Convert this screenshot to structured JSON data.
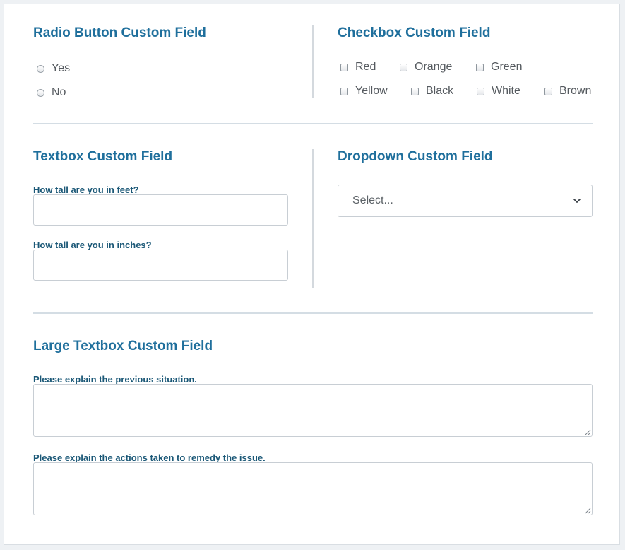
{
  "radio_section": {
    "title": "Radio Button Custom Field",
    "options": [
      {
        "label": "Yes"
      },
      {
        "label": "No"
      }
    ]
  },
  "checkbox_section": {
    "title": "Checkbox Custom Field",
    "options": [
      {
        "label": "Red"
      },
      {
        "label": "Orange"
      },
      {
        "label": "Green"
      },
      {
        "label": "Yellow"
      },
      {
        "label": "Black"
      },
      {
        "label": "White"
      },
      {
        "label": "Brown"
      }
    ]
  },
  "textbox_section": {
    "title": "Textbox Custom Field",
    "fields": [
      {
        "label": "How tall are you in feet?",
        "value": ""
      },
      {
        "label": "How tall are you in inches?",
        "value": ""
      }
    ]
  },
  "dropdown_section": {
    "title": "Dropdown Custom Field",
    "selected": "Select..."
  },
  "large_textbox_section": {
    "title": "Large Textbox Custom Field",
    "fields": [
      {
        "label": "Please explain the previous situation.",
        "value": ""
      },
      {
        "label": "Please explain the actions taken to remedy the issue.",
        "value": ""
      }
    ]
  },
  "icons": {
    "dropdown": "chevron-down-icon",
    "textarea_grip": "resize-grip-icon"
  },
  "colors": {
    "heading": "#1f6f9c",
    "field_label": "#1b5877",
    "option_text": "#555a5f",
    "border": "#c8ced4",
    "divider": "#d4d9de"
  }
}
